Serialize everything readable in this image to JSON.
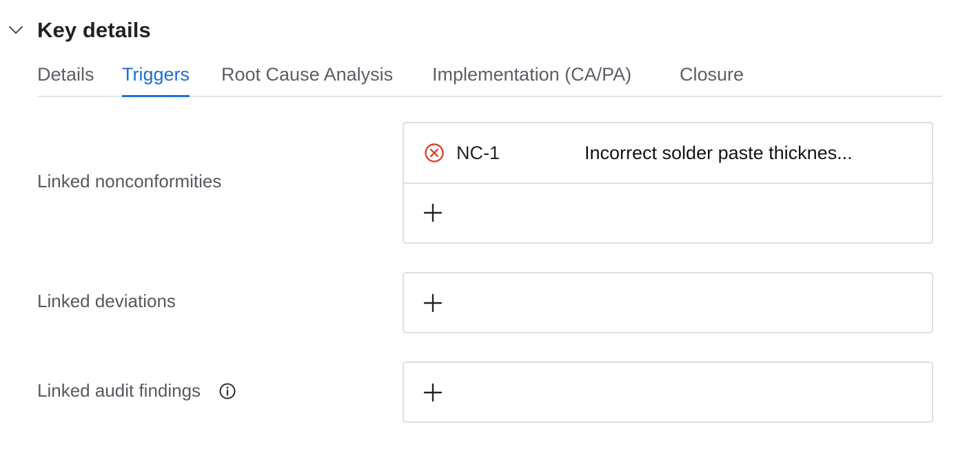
{
  "section": {
    "title": "Key details",
    "toggle_icon": "chevron-down-icon"
  },
  "tabs": [
    {
      "label": "Details",
      "active": false
    },
    {
      "label": "Triggers",
      "active": true
    },
    {
      "label": "Root Cause Analysis",
      "active": false
    },
    {
      "label": "Implementation (CA/PA)",
      "active": false
    },
    {
      "label": "Closure",
      "active": false
    }
  ],
  "fields": {
    "nonconformities": {
      "label": "Linked nonconformities",
      "items": [
        {
          "id": "NC-1",
          "title": "Incorrect solder paste thicknes...",
          "remove_icon": "remove-circle-icon"
        }
      ],
      "add_icon": "plus-icon"
    },
    "deviations": {
      "label": "Linked deviations",
      "add_icon": "plus-icon"
    },
    "audit_findings": {
      "label": "Linked audit findings",
      "info_icon": "info-icon",
      "add_icon": "plus-icon"
    }
  },
  "colors": {
    "accent": "#1b6fd3",
    "remove": "#d9412b",
    "border": "#dcdfe3",
    "text": "#1f2226",
    "muted": "#55595f"
  }
}
